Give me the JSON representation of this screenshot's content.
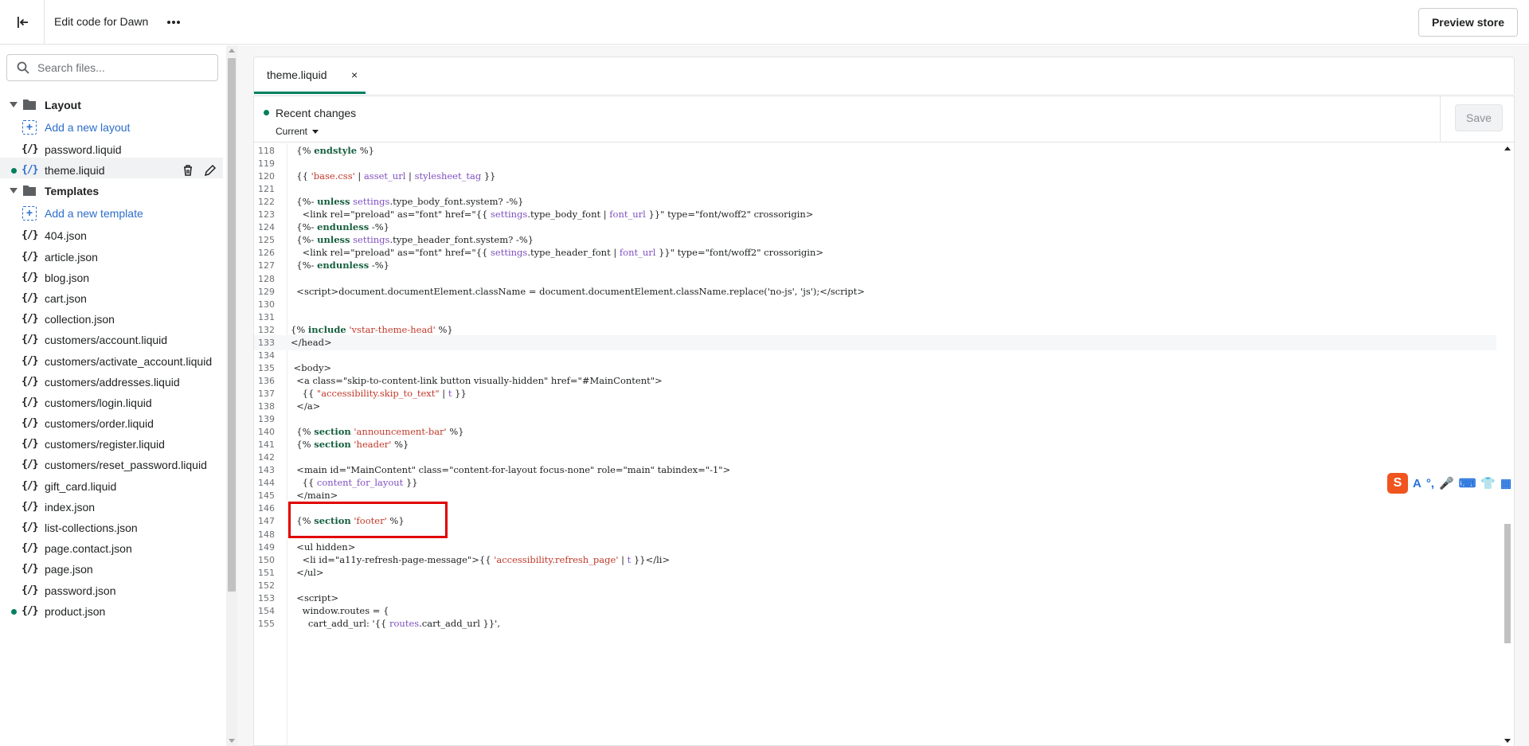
{
  "topbar": {
    "title": "Edit code for Dawn",
    "preview_label": "Preview store"
  },
  "sidebar": {
    "search_placeholder": "Search files...",
    "items": [
      {
        "type": "folder",
        "label": "Layout"
      },
      {
        "type": "add",
        "label": "Add a new layout"
      },
      {
        "type": "file",
        "label": "password.liquid"
      },
      {
        "type": "file",
        "label": "theme.liquid",
        "active": true,
        "modified": true
      },
      {
        "type": "folder",
        "label": "Templates"
      },
      {
        "type": "add",
        "label": "Add a new template"
      },
      {
        "type": "file",
        "label": "404.json"
      },
      {
        "type": "file",
        "label": "article.json"
      },
      {
        "type": "file",
        "label": "blog.json"
      },
      {
        "type": "file",
        "label": "cart.json"
      },
      {
        "type": "file",
        "label": "collection.json"
      },
      {
        "type": "file",
        "label": "customers/account.liquid"
      },
      {
        "type": "file",
        "label": "customers/activate_account.liquid"
      },
      {
        "type": "file",
        "label": "customers/addresses.liquid"
      },
      {
        "type": "file",
        "label": "customers/login.liquid"
      },
      {
        "type": "file",
        "label": "customers/order.liquid"
      },
      {
        "type": "file",
        "label": "customers/register.liquid"
      },
      {
        "type": "file",
        "label": "customers/reset_password.liquid"
      },
      {
        "type": "file",
        "label": "gift_card.liquid"
      },
      {
        "type": "file",
        "label": "index.json"
      },
      {
        "type": "file",
        "label": "list-collections.json"
      },
      {
        "type": "file",
        "label": "page.contact.json"
      },
      {
        "type": "file",
        "label": "page.json"
      },
      {
        "type": "file",
        "label": "password.json"
      },
      {
        "type": "file",
        "label": "product.json",
        "modified": true
      }
    ]
  },
  "editor": {
    "tab_label": "theme.liquid",
    "tab_close": "×",
    "recent_changes": "Recent changes",
    "current_label": "Current",
    "save_label": "Save",
    "lines": [
      {
        "n": "118",
        "html": "  {% <span class='kw'>endstyle</span> %}"
      },
      {
        "n": "119",
        "html": ""
      },
      {
        "n": "120",
        "html": "  {{ <span class='st'>'base.css'</span> | <span class='fn'>asset_url</span> | <span class='fn'>stylesheet_tag</span> }}"
      },
      {
        "n": "121",
        "html": ""
      },
      {
        "n": "122",
        "html": "  {%- <span class='kw'>unless</span> <span class='fn'>settings</span>.type_body_font.system? -%}"
      },
      {
        "n": "123",
        "html": "    &lt;link rel=\"preload\" as=\"font\" href=\"{{ <span class='fn'>settings</span>.type_body_font | <span class='fn'>font_url</span> }}\" type=\"font/woff2\" crossorigin&gt;"
      },
      {
        "n": "124",
        "html": "  {%- <span class='kw'>endunless</span> -%}"
      },
      {
        "n": "125",
        "html": "  {%- <span class='kw'>unless</span> <span class='fn'>settings</span>.type_header_font.system? -%}"
      },
      {
        "n": "126",
        "html": "    &lt;link rel=\"preload\" as=\"font\" href=\"{{ <span class='fn'>settings</span>.type_header_font | <span class='fn'>font_url</span> }}\" type=\"font/woff2\" crossorigin&gt;"
      },
      {
        "n": "127",
        "html": "  {%- <span class='kw'>endunless</span> -%}"
      },
      {
        "n": "128",
        "html": ""
      },
      {
        "n": "129",
        "html": "  &lt;script&gt;document.documentElement.className = document.documentElement.className.replace('no-js', 'js');&lt;/script&gt;"
      },
      {
        "n": "130",
        "html": ""
      },
      {
        "n": "131",
        "html": ""
      },
      {
        "n": "132",
        "html": "{% <span class='kw'>include</span> <span class='st'>'vstar-theme-head'</span> %}"
      },
      {
        "n": "133",
        "html": "&lt;/head&gt;",
        "hl": true
      },
      {
        "n": "134",
        "html": ""
      },
      {
        "n": "135",
        "html": " &lt;body&gt;"
      },
      {
        "n": "136",
        "html": "  &lt;a class=\"skip-to-content-link button visually-hidden\" href=\"#MainContent\"&gt;"
      },
      {
        "n": "137",
        "html": "    {{ <span class='st'>\"accessibility.skip_to_text\"</span> | <span class='fn'>t</span> }}"
      },
      {
        "n": "138",
        "html": "  &lt;/a&gt;"
      },
      {
        "n": "139",
        "html": ""
      },
      {
        "n": "140",
        "html": "  {% <span class='kw'>section</span> <span class='st'>'announcement-bar'</span> %}"
      },
      {
        "n": "141",
        "html": "  {% <span class='kw'>section</span> <span class='st'>'header'</span> %}"
      },
      {
        "n": "142",
        "html": ""
      },
      {
        "n": "143",
        "html": "  &lt;main id=\"MainContent\" class=\"content-for-layout focus-none\" role=\"main\" tabindex=\"-1\"&gt;"
      },
      {
        "n": "144",
        "html": "    {{ <span class='fn'>content_for_layout</span> }}"
      },
      {
        "n": "145",
        "html": "  &lt;/main&gt;"
      },
      {
        "n": "146",
        "html": ""
      },
      {
        "n": "147",
        "html": "  {% <span class='kw'>section</span> <span class='st'>'footer'</span> %}"
      },
      {
        "n": "148",
        "html": ""
      },
      {
        "n": "149",
        "html": "  &lt;ul hidden&gt;"
      },
      {
        "n": "150",
        "html": "    &lt;li id=\"a11y-refresh-page-message\"&gt;{{ <span class='st'>'accessibility.refresh_page'</span> | <span class='fn'>t</span> }}&lt;/li&gt;"
      },
      {
        "n": "151",
        "html": "  &lt;/ul&gt;"
      },
      {
        "n": "152",
        "html": ""
      },
      {
        "n": "153",
        "html": "  &lt;script&gt;"
      },
      {
        "n": "154",
        "html": "    window.routes = {"
      },
      {
        "n": "155",
        "html": "      cart_add_url: '{{ <span class='fn'>routes</span>.cart_add_url }}',"
      }
    ]
  },
  "ime": {
    "logo": "S",
    "icons": [
      "A",
      "°,",
      "🎤",
      "⌨",
      "👕",
      "▦"
    ]
  }
}
